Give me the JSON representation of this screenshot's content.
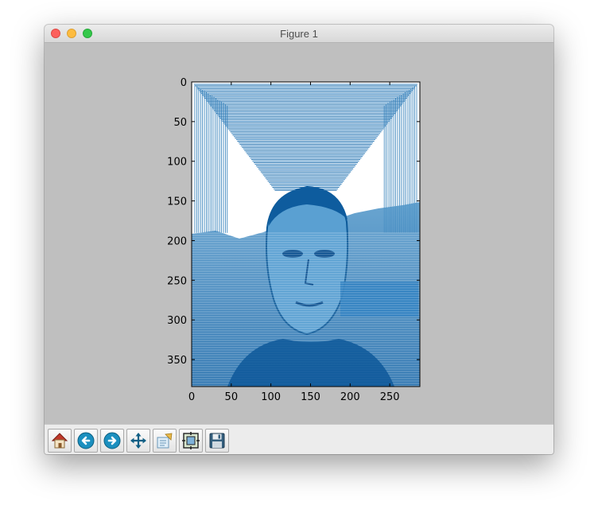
{
  "window": {
    "title": "Figure 1"
  },
  "toolbar": {
    "buttons": [
      {
        "name": "home",
        "icon": "home-icon"
      },
      {
        "name": "back",
        "icon": "arrow-left-icon"
      },
      {
        "name": "forward",
        "icon": "arrow-right-icon"
      },
      {
        "name": "pan",
        "icon": "move-arrows-icon"
      },
      {
        "name": "zoom",
        "icon": "zoom-rect-icon"
      },
      {
        "name": "subplots",
        "icon": "configure-subplots-icon"
      },
      {
        "name": "save",
        "icon": "floppy-disk-icon"
      }
    ]
  },
  "chart_data": {
    "type": "heatmap",
    "title": "",
    "xlabel": "",
    "ylabel": "",
    "xlim": [
      0,
      288
    ],
    "ylim": [
      384,
      0
    ],
    "xticks": [
      0,
      50,
      100,
      150,
      200,
      250
    ],
    "yticks": [
      0,
      50,
      100,
      150,
      200,
      250,
      300,
      350
    ],
    "colormap": "blues",
    "image_size": [
      288,
      384
    ],
    "content": "contour-like image of a person's face in shades of blue on white"
  }
}
